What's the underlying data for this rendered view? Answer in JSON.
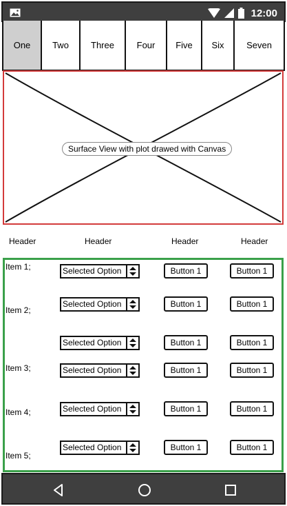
{
  "status_bar": {
    "time": "12:00",
    "icons": [
      "image-icon",
      "wifi-icon",
      "signal-icon",
      "battery-icon"
    ]
  },
  "tabs": [
    {
      "label": "One",
      "active": true
    },
    {
      "label": "Two",
      "active": false
    },
    {
      "label": "Three",
      "active": false
    },
    {
      "label": "Four",
      "active": false
    },
    {
      "label": "Five",
      "active": false
    },
    {
      "label": "Six",
      "active": false
    },
    {
      "label": "Seven",
      "active": false
    }
  ],
  "surface": {
    "caption": "Surface View with plot drawed with Canvas",
    "border_color": "#d33a3a"
  },
  "headers": [
    "Header",
    "Header",
    "Header",
    "Header"
  ],
  "grid": {
    "border_color": "#3aa04a",
    "items": [
      "Item 1;",
      "Item 2;",
      "Item 3;",
      "Item 4;",
      "Item 5;"
    ],
    "rows": [
      {
        "select": "Selected Option",
        "button_a": "Button 1",
        "button_b": "Button 1"
      },
      {
        "select": "Selected Option",
        "button_a": "Button 1",
        "button_b": "Button 1"
      },
      {
        "select": "Selected Option",
        "button_a": "Button 1",
        "button_b": "Button 1"
      },
      {
        "select": "Selected Option",
        "button_a": "Button 1",
        "button_b": "Button 1"
      },
      {
        "select": "Selected Option",
        "button_a": "Button 1",
        "button_b": "Button 1"
      },
      {
        "select": "Selected Option",
        "button_a": "Button 1",
        "button_b": "Button 1"
      }
    ]
  },
  "nav_bar": {
    "buttons": [
      "back-icon",
      "home-icon",
      "recents-icon"
    ]
  }
}
